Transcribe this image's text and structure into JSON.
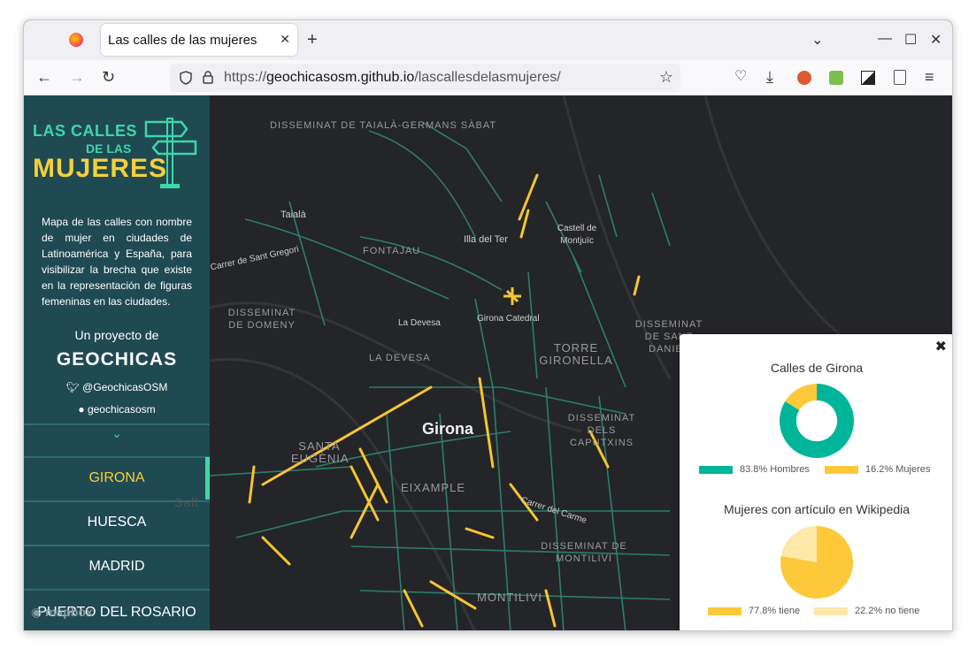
{
  "browser": {
    "tab_title": "Las calles de las mujeres",
    "url_scheme": "https://",
    "url_host": "geochicasosm.github.io",
    "url_path": "/lascallesdelasmujeres/"
  },
  "sidebar": {
    "logo_line1": "LAS CALLES",
    "logo_line2": "DE LAS",
    "logo_line3": "MUJERES",
    "description": "Mapa de las calles con nombre de mujer en ciudades de Latinoamérica y España, para visibilizar la brecha que existe en la representación de figuras femeninas en las ciudades.",
    "byline": "Un proyecto de",
    "brand": "GEOCHICAS",
    "twitter": "@GeochicasOSM",
    "github": "geochicasosm",
    "cities": [
      "GIRONA",
      "HUESCA",
      "MADRID",
      "PUERTO DEL ROSARIO"
    ],
    "active_city": "GIRONA",
    "attribution": "mapbox"
  },
  "map": {
    "labels": [
      {
        "text": "DISSEMINAT DE TAIALÀ-GERMANS SÀBAT"
      },
      {
        "text": "Taialà"
      },
      {
        "text": "FONTAJAU"
      },
      {
        "text": "Illa del Ter"
      },
      {
        "text": "Castell de Montjuïc"
      },
      {
        "text": "Carrer de Sant Gregori"
      },
      {
        "text": "DISSEMINAT DE DOMENY"
      },
      {
        "text": "La Devesa"
      },
      {
        "text": "Girona Catedral"
      },
      {
        "text": "DISSEMINAT DE SANT DANIEL"
      },
      {
        "text": "LA DEVESA"
      },
      {
        "text": "TORRE GIRONELLA"
      },
      {
        "text": "DISSEMINAT DELS CAPUTXINS"
      },
      {
        "text": "Girona"
      },
      {
        "text": "SANTA EUGÈNIA"
      },
      {
        "text": "EIXAMPLE"
      },
      {
        "text": "Carrer del Carme"
      },
      {
        "text": "DISSEMINAT DE MONTILIVI"
      },
      {
        "text": "MONTILIVI"
      },
      {
        "text": "Salt"
      }
    ],
    "colors": {
      "women": "#f6c531",
      "men": "#1fb89a",
      "background": "#242528"
    }
  },
  "stats_panel": {
    "chart1_title": "Calles de Girona",
    "chart2_title": "Mujeres con artículo en Wikipedia",
    "legend": {
      "men": "83.8% Hombres",
      "women": "16.2% Mujeres",
      "with_article": "77.8% tiene",
      "without_article": "22.2% no tiene"
    }
  },
  "chart_data": [
    {
      "type": "pie",
      "title": "Calles de Girona",
      "donut": true,
      "categories": [
        "Hombres",
        "Mujeres"
      ],
      "values": [
        83.8,
        16.2
      ],
      "colors": [
        "#00b59a",
        "#fdc93a"
      ]
    },
    {
      "type": "pie",
      "title": "Mujeres con artículo en Wikipedia",
      "donut": false,
      "categories": [
        "tiene",
        "no tiene"
      ],
      "values": [
        77.8,
        22.2
      ],
      "colors": [
        "#fdc93a",
        "#fde8a8"
      ]
    }
  ]
}
